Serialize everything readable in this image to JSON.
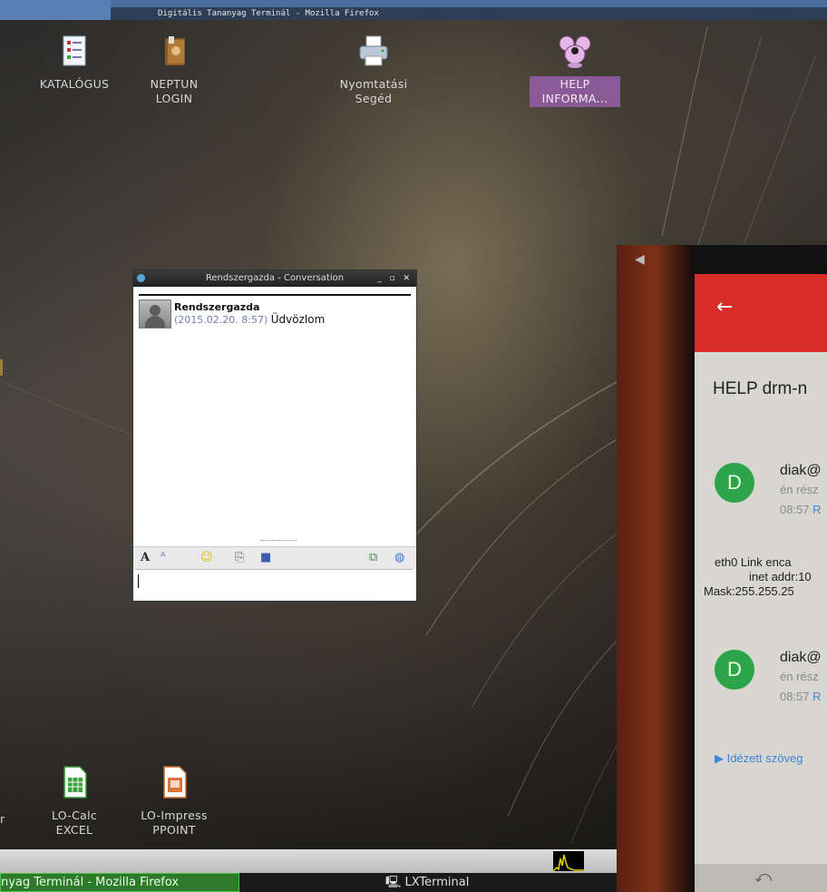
{
  "window_title": "Digitális Tananyag Terminál - Mozilla Firefox",
  "desktop_icons": [
    {
      "label": "KATALÓGUS"
    },
    {
      "label": "NEPTUN\nLOGIN"
    },
    {
      "label": "Nyomtatási\nSegéd"
    },
    {
      "label": "HELP\nINFORMA..."
    },
    {
      "label": "LO-Calc\nEXCEL"
    },
    {
      "label": "LO-Impress\nPPOINT"
    }
  ],
  "chat": {
    "title": "Rendszergazda - Conversation",
    "sender": "Rendszergazda",
    "timestamp": "(2015.02.20. 8:57)",
    "message": "Üdvözlom"
  },
  "taskbar": {
    "task1": "nyag Terminál - Mozilla Firefox",
    "task2": "LXTerminal"
  },
  "phone": {
    "subject": "HELP drm-n",
    "mail1": {
      "avatar": "D",
      "from": "diak@",
      "to": "én rész",
      "time": "08:57",
      "time_suffix": "R"
    },
    "body_lines": [
      "eth0    Link enca",
      "inet addr:10",
      "Mask:255.255.25"
    ],
    "mail2": {
      "avatar": "D",
      "from": "diak@",
      "to": "én rész",
      "time": "08:57",
      "time_suffix": "R"
    },
    "quoted": "▶ Idézett szöveg"
  },
  "colors": {
    "selected_label_bg": "#8a5a96",
    "active_task": "#2d7a2a",
    "gmail_red": "#d92d27",
    "avatar_green": "#2ea44a"
  }
}
